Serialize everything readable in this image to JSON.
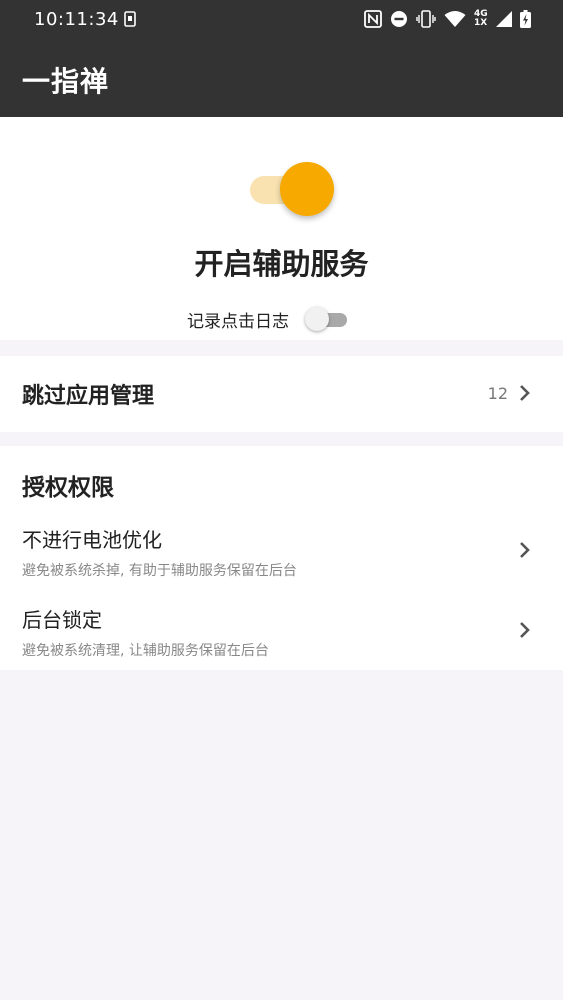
{
  "status_bar": {
    "time": "10:11:34",
    "network_label_top": "4G",
    "network_label_bottom": "1X",
    "icons": [
      "notification-icon",
      "nfc-icon",
      "do-not-disturb-icon",
      "vibrate-icon",
      "wifi-icon",
      "signal-icon",
      "battery-icon"
    ]
  },
  "app_bar": {
    "title": "一指禅"
  },
  "service": {
    "title": "开启辅助服务",
    "enabled": true,
    "accent_color": "#f7a900",
    "log_label": "记录点击日志",
    "log_enabled": false
  },
  "skip_apps": {
    "label": "跳过应用管理",
    "count": "12"
  },
  "permissions": {
    "header": "授权权限",
    "items": [
      {
        "title": "不进行电池优化",
        "desc": "避免被系统杀掉, 有助于辅助服务保留在后台"
      },
      {
        "title": "后台锁定",
        "desc": "避免被系统清理, 让辅助服务保留在后台"
      }
    ]
  }
}
